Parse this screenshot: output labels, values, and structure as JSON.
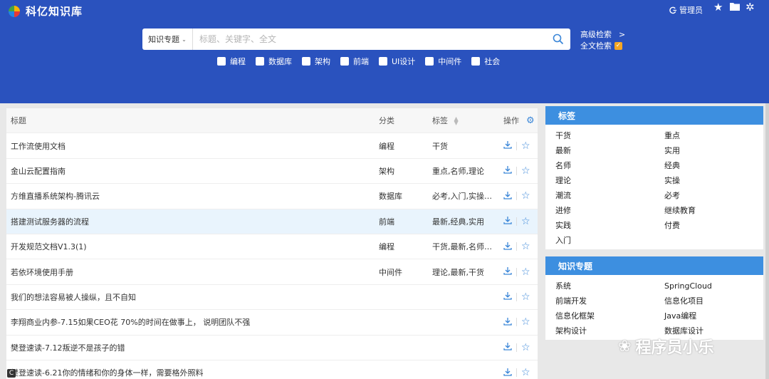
{
  "app": {
    "title": "科亿知识库"
  },
  "header": {
    "admin_label": "管理员",
    "search": {
      "topic_label": "知识专题",
      "placeholder": "标题、关键字、全文"
    },
    "advanced_label": "高级检索",
    "advanced_arrow": ">",
    "fulltext_label": "全文检索",
    "fulltext_checked": true,
    "categories": [
      "编程",
      "数据库",
      "架构",
      "前端",
      "UI设计",
      "中间件",
      "社会"
    ]
  },
  "table": {
    "columns": {
      "title": "标题",
      "category": "分类",
      "tags": "标签",
      "actions": "操作"
    },
    "rows": [
      {
        "title": "工作流使用文档",
        "category": "编程",
        "tags": "干货"
      },
      {
        "title": "金山云配置指南",
        "category": "架构",
        "tags": "重点,名师,理论"
      },
      {
        "title": "方维直播系统架构-腾讯云",
        "category": "数据库",
        "tags": "必考,入门,实操,..."
      },
      {
        "title": "搭建测试服务器的流程",
        "category": "前端",
        "tags": "最新,经典,实用"
      },
      {
        "title": "开发规范文档V1.3(1)",
        "category": "编程",
        "tags": "干货,最新,名师,..."
      },
      {
        "title": "若依环境使用手册",
        "category": "中间件",
        "tags": "理论,最新,干货"
      },
      {
        "title": "我们的想法容易被人操纵，且不自知",
        "category": "",
        "tags": ""
      },
      {
        "title": "李翔商业内参-7.15如果CEO花 70%的时间在做事上， 说明团队不强",
        "category": "",
        "tags": ""
      },
      {
        "title": "樊登速读-7.12叛逆不是孩子的错",
        "category": "",
        "tags": ""
      },
      {
        "title": "樊登速读-6.21你的情绪和你的身体一样，需要格外照料",
        "category": "",
        "tags": ""
      }
    ]
  },
  "tags_panel": {
    "title": "标签",
    "items": [
      "干货",
      "重点",
      "最新",
      "实用",
      "名师",
      "经典",
      "理论",
      "实操",
      "潮流",
      "必考",
      "进修",
      "继续教育",
      "实践",
      "付费",
      "入门"
    ]
  },
  "topics_panel": {
    "title": "知识专题",
    "items": [
      "系统",
      "SpringCloud",
      "前端开发",
      "信息化项目",
      "信息化框架",
      "Java编程",
      "架构设计",
      "数据库设计"
    ]
  },
  "watermark": "程序员小乐",
  "colors": {
    "header_bg": "#2a52be",
    "panel_head": "#3d8fe0",
    "accent": "#3a86d8",
    "check": "#f5a623"
  }
}
